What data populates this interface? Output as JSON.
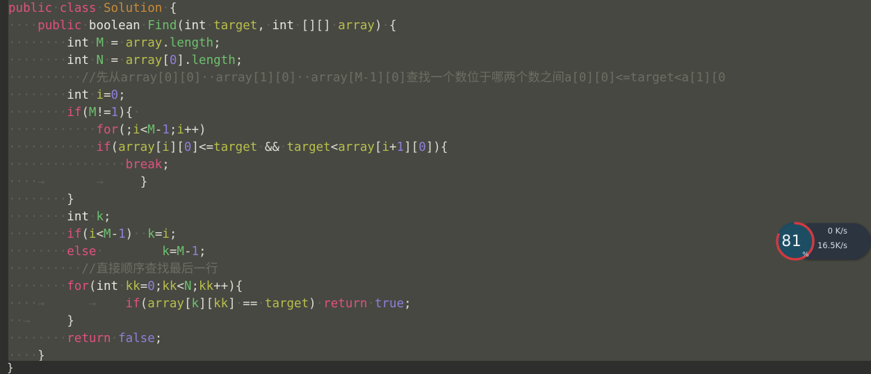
{
  "window": {
    "kind": "code-editor",
    "language": "Java",
    "background_color": "#474842",
    "gutter_color": "#2e2e2c"
  },
  "colors": {
    "keyword": "#e0527e",
    "type": "#e8e8e0",
    "identifier": "#6ec06e",
    "variable": "#b9bf4a",
    "number": "#8f7fd8",
    "class_name": "#c98b38",
    "comment": "#6d6e63",
    "punctuation": "#dcdcd2",
    "whitespace_dot": "#5e5f57"
  },
  "editor": {
    "lines": [
      [
        {
          "t": "public",
          "c": "kw"
        },
        {
          "t": "·",
          "c": "ws"
        },
        {
          "t": "class",
          "c": "kw"
        },
        {
          "t": "·",
          "c": "ws"
        },
        {
          "t": "Solution",
          "c": "cls"
        },
        {
          "t": "·",
          "c": "ws"
        },
        {
          "t": "{",
          "c": "punc"
        }
      ],
      [
        {
          "t": "····",
          "c": "ws"
        },
        {
          "t": "public",
          "c": "kw"
        },
        {
          "t": "·",
          "c": "ws"
        },
        {
          "t": "boolean",
          "c": "type"
        },
        {
          "t": "·",
          "c": "ws"
        },
        {
          "t": "Find",
          "c": "ident"
        },
        {
          "t": "(",
          "c": "punc"
        },
        {
          "t": "int",
          "c": "type"
        },
        {
          "t": "·",
          "c": "ws"
        },
        {
          "t": "target",
          "c": "var"
        },
        {
          "t": ",",
          "c": "punc"
        },
        {
          "t": "·",
          "c": "ws"
        },
        {
          "t": "int",
          "c": "type"
        },
        {
          "t": "·",
          "c": "ws"
        },
        {
          "t": "[][]",
          "c": "punc"
        },
        {
          "t": "·",
          "c": "ws"
        },
        {
          "t": "array",
          "c": "var"
        },
        {
          "t": ")",
          "c": "punc"
        },
        {
          "t": "·",
          "c": "ws"
        },
        {
          "t": "{",
          "c": "punc"
        }
      ],
      [
        {
          "t": "······",
          "c": "ws"
        },
        {
          "t": "··",
          "c": "ws"
        },
        {
          "t": "int",
          "c": "type"
        },
        {
          "t": "·",
          "c": "ws"
        },
        {
          "t": "M",
          "c": "ident"
        },
        {
          "t": "·",
          "c": "ws"
        },
        {
          "t": "=",
          "c": "punc"
        },
        {
          "t": "·",
          "c": "ws"
        },
        {
          "t": "array",
          "c": "var"
        },
        {
          "t": ".",
          "c": "punc"
        },
        {
          "t": "length",
          "c": "ident"
        },
        {
          "t": ";",
          "c": "punc"
        }
      ],
      [
        {
          "t": "········",
          "c": "ws"
        },
        {
          "t": "int",
          "c": "type"
        },
        {
          "t": "·",
          "c": "ws"
        },
        {
          "t": "N",
          "c": "ident"
        },
        {
          "t": "·",
          "c": "ws"
        },
        {
          "t": "=",
          "c": "punc"
        },
        {
          "t": "·",
          "c": "ws"
        },
        {
          "t": "array",
          "c": "var"
        },
        {
          "t": "[",
          "c": "punc"
        },
        {
          "t": "0",
          "c": "num"
        },
        {
          "t": "]",
          "c": "punc"
        },
        {
          "t": ".",
          "c": "punc"
        },
        {
          "t": "length",
          "c": "ident"
        },
        {
          "t": ";",
          "c": "punc"
        }
      ],
      [
        {
          "t": "········",
          "c": "ws"
        },
        {
          "t": "··",
          "c": "ws"
        },
        {
          "t": "//先从array[0][0]··array[1][0]··array[M-1][0]查找一个数位于哪两个数之间a[0][0]<=target<a[1][0",
          "c": "comment"
        }
      ],
      [
        {
          "t": "········",
          "c": "ws"
        },
        {
          "t": "int",
          "c": "type"
        },
        {
          "t": "·",
          "c": "ws"
        },
        {
          "t": "i",
          "c": "var"
        },
        {
          "t": "=",
          "c": "punc"
        },
        {
          "t": "0",
          "c": "num"
        },
        {
          "t": ";",
          "c": "punc"
        }
      ],
      [
        {
          "t": "········",
          "c": "ws"
        },
        {
          "t": "if",
          "c": "kw"
        },
        {
          "t": "(",
          "c": "punc"
        },
        {
          "t": "M",
          "c": "ident"
        },
        {
          "t": "!=",
          "c": "punc"
        },
        {
          "t": "1",
          "c": "num"
        },
        {
          "t": ")",
          "c": "punc"
        },
        {
          "t": "{",
          "c": "punc"
        },
        {
          "t": "·",
          "c": "ws"
        }
      ],
      [
        {
          "t": "········",
          "c": "ws"
        },
        {
          "t": "····",
          "c": "ws"
        },
        {
          "t": "for",
          "c": "kw"
        },
        {
          "t": "(;",
          "c": "punc"
        },
        {
          "t": "i",
          "c": "var"
        },
        {
          "t": "<",
          "c": "punc"
        },
        {
          "t": "M",
          "c": "ident"
        },
        {
          "t": "-",
          "c": "punc"
        },
        {
          "t": "1",
          "c": "num"
        },
        {
          "t": ";",
          "c": "punc"
        },
        {
          "t": "i",
          "c": "var"
        },
        {
          "t": "++)",
          "c": "punc"
        }
      ],
      [
        {
          "t": "············",
          "c": "ws"
        },
        {
          "t": "if",
          "c": "kw"
        },
        {
          "t": "(",
          "c": "punc"
        },
        {
          "t": "array",
          "c": "var"
        },
        {
          "t": "[",
          "c": "punc"
        },
        {
          "t": "i",
          "c": "var"
        },
        {
          "t": "][",
          "c": "punc"
        },
        {
          "t": "0",
          "c": "num"
        },
        {
          "t": "]<=",
          "c": "punc"
        },
        {
          "t": "target",
          "c": "var"
        },
        {
          "t": "·",
          "c": "ws"
        },
        {
          "t": "&&",
          "c": "punc"
        },
        {
          "t": "·",
          "c": "ws"
        },
        {
          "t": "target",
          "c": "var"
        },
        {
          "t": "<",
          "c": "punc"
        },
        {
          "t": "array",
          "c": "var"
        },
        {
          "t": "[",
          "c": "punc"
        },
        {
          "t": "i",
          "c": "var"
        },
        {
          "t": "+",
          "c": "punc"
        },
        {
          "t": "1",
          "c": "num"
        },
        {
          "t": "][",
          "c": "punc"
        },
        {
          "t": "0",
          "c": "num"
        },
        {
          "t": "])",
          "c": "punc"
        },
        {
          "t": "{",
          "c": "punc"
        }
      ],
      [
        {
          "t": "··············",
          "c": "ws"
        },
        {
          "t": "··",
          "c": "ws"
        },
        {
          "t": "break",
          "c": "kw"
        },
        {
          "t": ";",
          "c": "punc"
        }
      ],
      [
        {
          "t": "····",
          "c": "ws"
        },
        {
          "t": "→",
          "c": "tabarrow"
        },
        {
          "t": "       ",
          "c": "ws"
        },
        {
          "t": "→",
          "c": "tabarrow"
        },
        {
          "t": "     ",
          "c": "ws"
        },
        {
          "t": "}",
          "c": "punc"
        }
      ],
      [
        {
          "t": "········",
          "c": "ws"
        },
        {
          "t": "}",
          "c": "punc"
        }
      ],
      [
        {
          "t": "········",
          "c": "ws"
        },
        {
          "t": "int",
          "c": "type"
        },
        {
          "t": "·",
          "c": "ws"
        },
        {
          "t": "k",
          "c": "ident"
        },
        {
          "t": ";",
          "c": "punc"
        }
      ],
      [
        {
          "t": "········",
          "c": "ws"
        },
        {
          "t": "if",
          "c": "kw"
        },
        {
          "t": "(",
          "c": "punc"
        },
        {
          "t": "i",
          "c": "var"
        },
        {
          "t": "<",
          "c": "punc"
        },
        {
          "t": "M",
          "c": "ident"
        },
        {
          "t": "-",
          "c": "punc"
        },
        {
          "t": "1",
          "c": "num"
        },
        {
          "t": ")",
          "c": "punc"
        },
        {
          "t": "··",
          "c": "ws"
        },
        {
          "t": "k",
          "c": "ident"
        },
        {
          "t": "=",
          "c": "punc"
        },
        {
          "t": "i",
          "c": "var"
        },
        {
          "t": ";",
          "c": "punc"
        }
      ],
      [
        {
          "t": "········",
          "c": "ws"
        },
        {
          "t": "else",
          "c": "kw"
        },
        {
          "t": "·",
          "c": "ws"
        },
        {
          "t": "        ",
          "c": "ws"
        },
        {
          "t": "k",
          "c": "ident"
        },
        {
          "t": "=",
          "c": "punc"
        },
        {
          "t": "M",
          "c": "ident"
        },
        {
          "t": "-",
          "c": "punc"
        },
        {
          "t": "1",
          "c": "num"
        },
        {
          "t": ";",
          "c": "punc"
        }
      ],
      [
        {
          "t": "········",
          "c": "ws"
        },
        {
          "t": "··",
          "c": "ws"
        },
        {
          "t": "//直接顺序查找最后一行",
          "c": "comment"
        }
      ],
      [
        {
          "t": "········",
          "c": "ws"
        },
        {
          "t": "for",
          "c": "kw"
        },
        {
          "t": "(",
          "c": "punc"
        },
        {
          "t": "int",
          "c": "type"
        },
        {
          "t": "·",
          "c": "ws"
        },
        {
          "t": "kk",
          "c": "var"
        },
        {
          "t": "=",
          "c": "punc"
        },
        {
          "t": "0",
          "c": "num"
        },
        {
          "t": ";",
          "c": "punc"
        },
        {
          "t": "kk",
          "c": "var"
        },
        {
          "t": "<",
          "c": "punc"
        },
        {
          "t": "N",
          "c": "ident"
        },
        {
          "t": ";",
          "c": "punc"
        },
        {
          "t": "kk",
          "c": "var"
        },
        {
          "t": "++)",
          "c": "punc"
        },
        {
          "t": "{",
          "c": "punc"
        }
      ],
      [
        {
          "t": "····",
          "c": "ws"
        },
        {
          "t": "→",
          "c": "tabarrow"
        },
        {
          "t": "      ",
          "c": "ws"
        },
        {
          "t": "→",
          "c": "tabarrow"
        },
        {
          "t": "    ",
          "c": "ws"
        },
        {
          "t": "if",
          "c": "kw"
        },
        {
          "t": "(",
          "c": "punc"
        },
        {
          "t": "array",
          "c": "var"
        },
        {
          "t": "[",
          "c": "punc"
        },
        {
          "t": "k",
          "c": "ident"
        },
        {
          "t": "][",
          "c": "punc"
        },
        {
          "t": "kk",
          "c": "var"
        },
        {
          "t": "]",
          "c": "punc"
        },
        {
          "t": "·",
          "c": "ws"
        },
        {
          "t": "==",
          "c": "punc"
        },
        {
          "t": "·",
          "c": "ws"
        },
        {
          "t": "target",
          "c": "var"
        },
        {
          "t": ")",
          "c": "punc"
        },
        {
          "t": "·",
          "c": "ws"
        },
        {
          "t": "return",
          "c": "kw"
        },
        {
          "t": "·",
          "c": "ws"
        },
        {
          "t": "true",
          "c": "lit"
        },
        {
          "t": ";",
          "c": "punc"
        }
      ],
      [
        {
          "t": "··",
          "c": "ws"
        },
        {
          "t": "→",
          "c": "tabarrow"
        },
        {
          "t": "     ",
          "c": "ws"
        },
        {
          "t": "}",
          "c": "punc"
        }
      ],
      [
        {
          "t": "········",
          "c": "ws"
        },
        {
          "t": "return",
          "c": "kw"
        },
        {
          "t": "·",
          "c": "ws"
        },
        {
          "t": "false",
          "c": "lit"
        },
        {
          "t": ";",
          "c": "punc"
        }
      ],
      [
        {
          "t": "····",
          "c": "ws"
        },
        {
          "t": "}",
          "c": "punc"
        }
      ]
    ]
  },
  "bottom_pane": {
    "lines": [
      [
        {
          "t": "}",
          "c": "punc"
        }
      ]
    ]
  },
  "net_widget": {
    "cpu_percent": "81",
    "percent_symbol": "%",
    "ring_color": "#d13a3f",
    "ring_track_color": "#1f4a5e",
    "dial_fill_color": "#1d4d63",
    "pill_color": "#2c3440",
    "upload": {
      "arrow": "↑",
      "value": "0 K/s",
      "color": "#3d9ee0"
    },
    "download": {
      "arrow": "↓",
      "value": "16.5K/s",
      "color": "#e8a43a"
    }
  }
}
